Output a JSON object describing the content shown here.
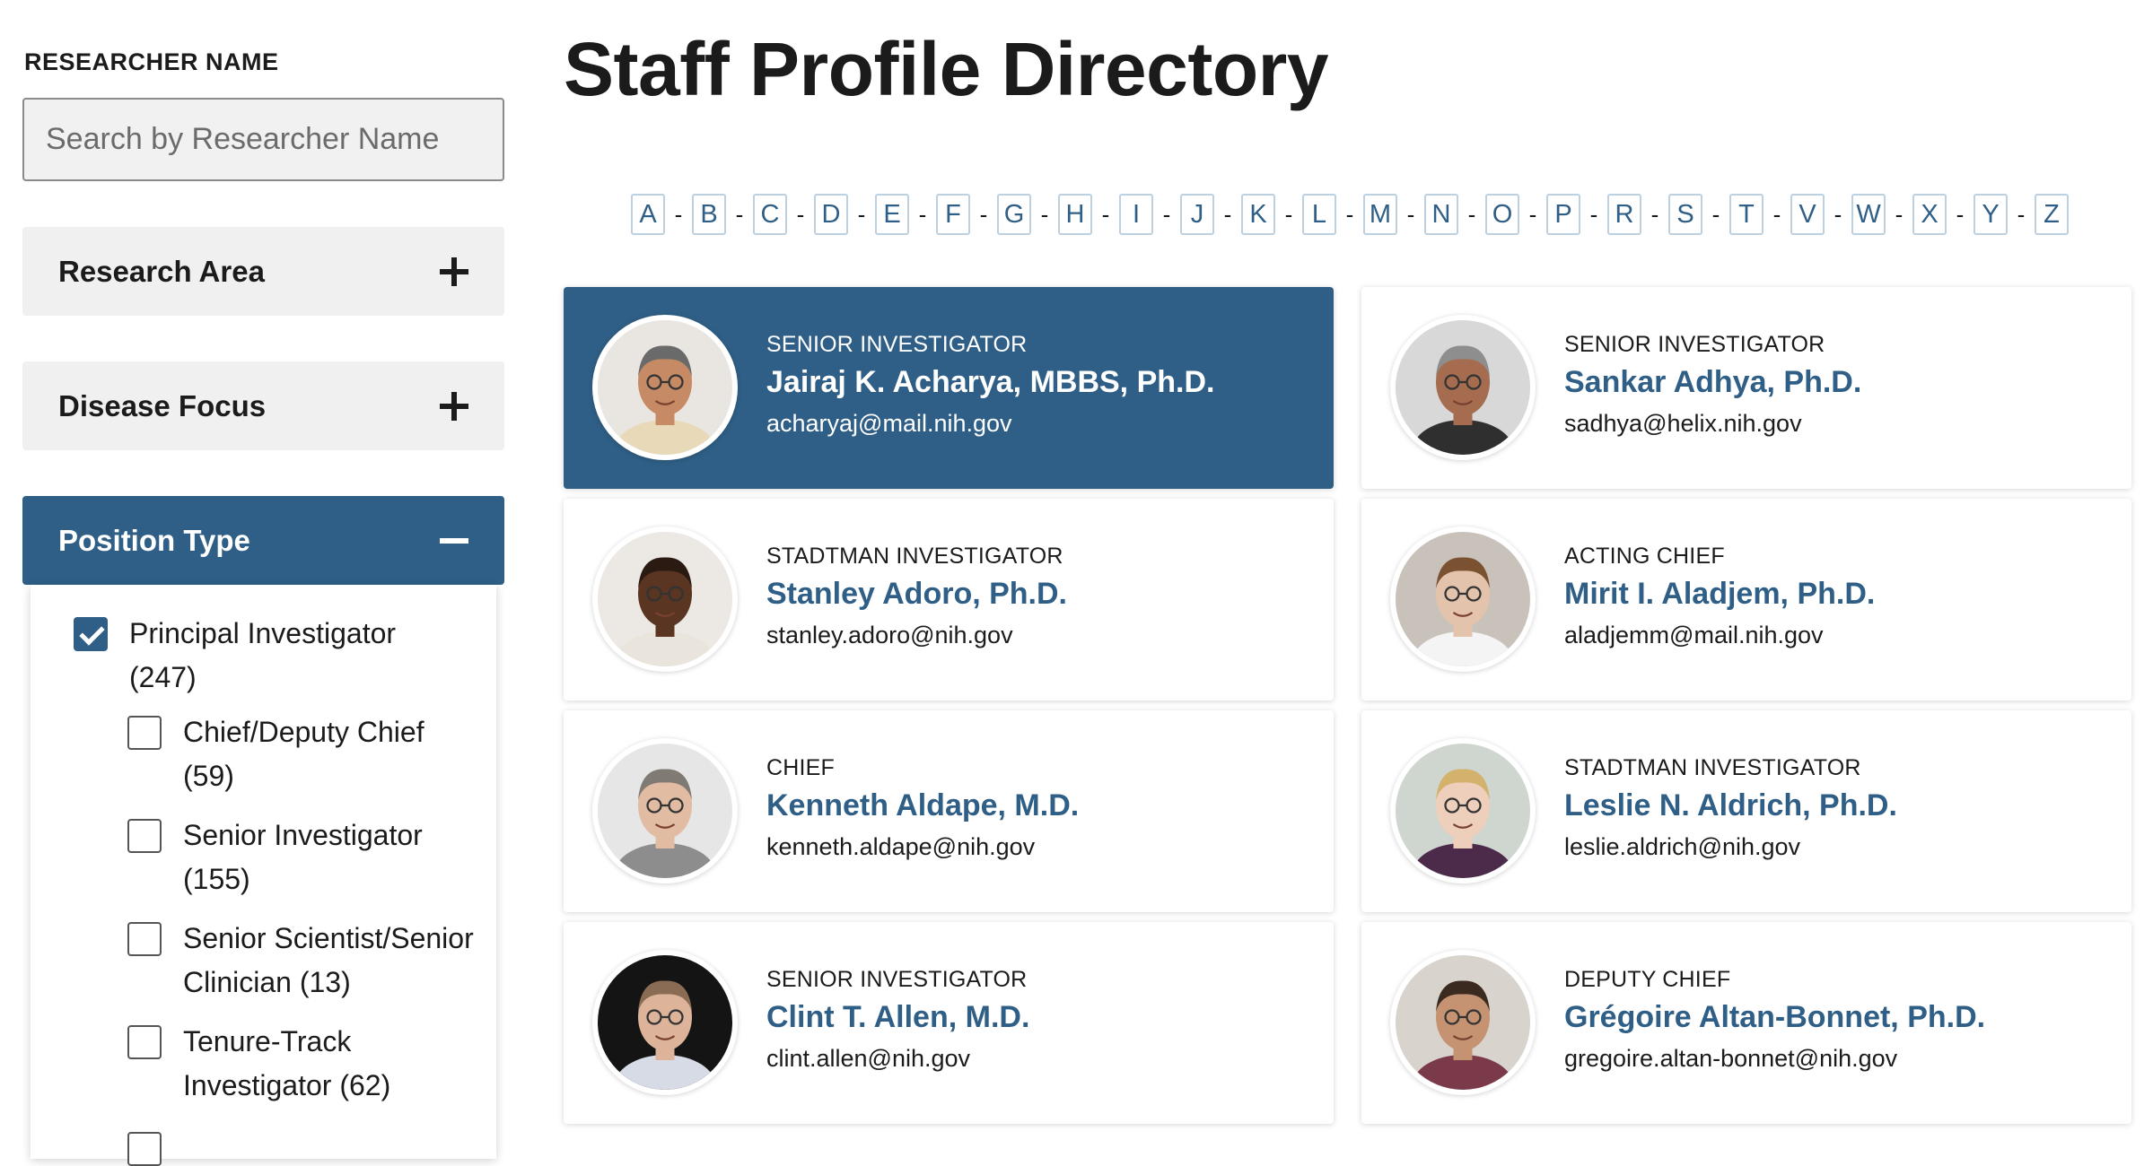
{
  "sidebar": {
    "researcher_label": "RESEARCHER NAME",
    "search_placeholder": "Search by Researcher Name",
    "accordions": [
      {
        "label": "Research Area",
        "expanded": false
      },
      {
        "label": "Disease Focus",
        "expanded": false
      },
      {
        "label": "Position Type",
        "expanded": true
      }
    ],
    "position_options": [
      {
        "label": "Principal Investigator (247)",
        "checked": true
      },
      {
        "label": "Chief/Deputy Chief (59)",
        "checked": false
      },
      {
        "label": "Senior Investigator (155)",
        "checked": false
      },
      {
        "label": "Senior Scientist/Senior Clinician (13)",
        "checked": false
      },
      {
        "label": "Tenure-Track Investigator (62)",
        "checked": false
      }
    ]
  },
  "header": {
    "title": "Staff Profile Directory"
  },
  "alphabet": [
    "A",
    "B",
    "C",
    "D",
    "E",
    "F",
    "G",
    "H",
    "I",
    "J",
    "K",
    "L",
    "M",
    "N",
    "O",
    "P",
    "R",
    "S",
    "T",
    "V",
    "W",
    "X",
    "Y",
    "Z"
  ],
  "profiles": [
    {
      "role": "SENIOR INVESTIGATOR",
      "name": "Jairaj K. Acharya, MBBS, Ph.D.",
      "email": "acharyaj@mail.nih.gov",
      "active": true
    },
    {
      "role": "SENIOR INVESTIGATOR",
      "name": "Sankar Adhya, Ph.D.",
      "email": "sadhya@helix.nih.gov",
      "active": false
    },
    {
      "role": "STADTMAN INVESTIGATOR",
      "name": "Stanley Adoro, Ph.D.",
      "email": "stanley.adoro@nih.gov",
      "active": false
    },
    {
      "role": "ACTING CHIEF",
      "name": "Mirit I. Aladjem, Ph.D.",
      "email": "aladjemm@mail.nih.gov",
      "active": false
    },
    {
      "role": "CHIEF",
      "name": "Kenneth Aldape, M.D.",
      "email": "kenneth.aldape@nih.gov",
      "active": false
    },
    {
      "role": "STADTMAN INVESTIGATOR",
      "name": "Leslie N. Aldrich, Ph.D.",
      "email": "leslie.aldrich@nih.gov",
      "active": false
    },
    {
      "role": "SENIOR INVESTIGATOR",
      "name": "Clint T. Allen, M.D.",
      "email": "clint.allen@nih.gov",
      "active": false
    },
    {
      "role": "DEPUTY CHIEF",
      "name": "Grégoire Altan-Bonnet, Ph.D.",
      "email": "gregoire.altan-bonnet@nih.gov",
      "active": false
    }
  ],
  "colors": {
    "accent": "#2f5f86",
    "panel_bg": "#f0f0f0"
  }
}
